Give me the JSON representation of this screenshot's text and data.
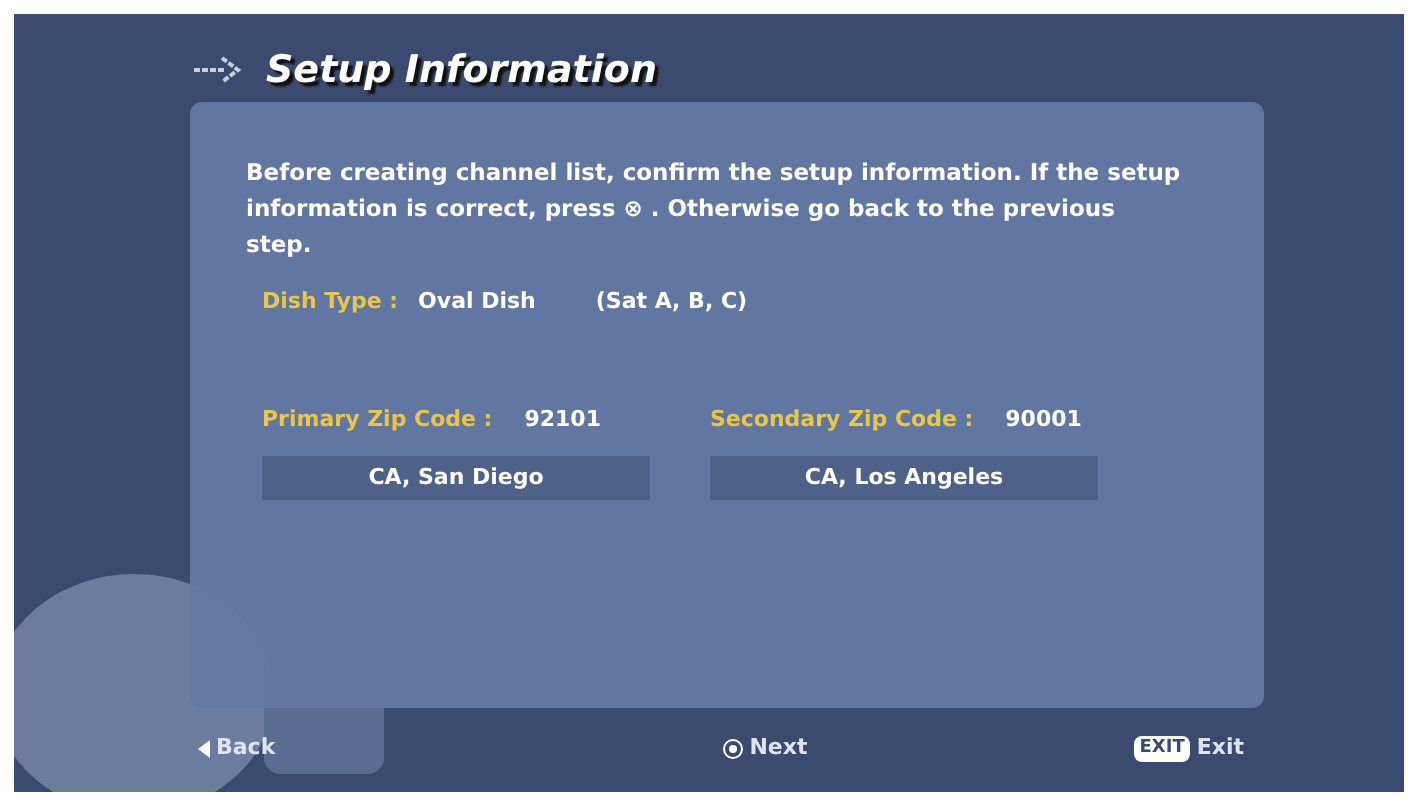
{
  "title": "Setup Information",
  "message": "Before creating channel list, confirm the setup information. If the setup information is correct, press ⊗ . Otherwise go back to the previous step.",
  "dish": {
    "label": "Dish Type :",
    "value": "Oval Dish",
    "satellites": "(Sat A, B, C)"
  },
  "zip_codes": [
    {
      "label": "Primary Zip Code :",
      "value": "92101",
      "location": "CA, San Diego"
    },
    {
      "label": "Secondary Zip Code :",
      "value": "90001",
      "location": "CA, Los Angeles"
    }
  ],
  "footer": {
    "back": "Back",
    "next": "Next",
    "exit_key": "EXIT",
    "exit": "Exit"
  }
}
